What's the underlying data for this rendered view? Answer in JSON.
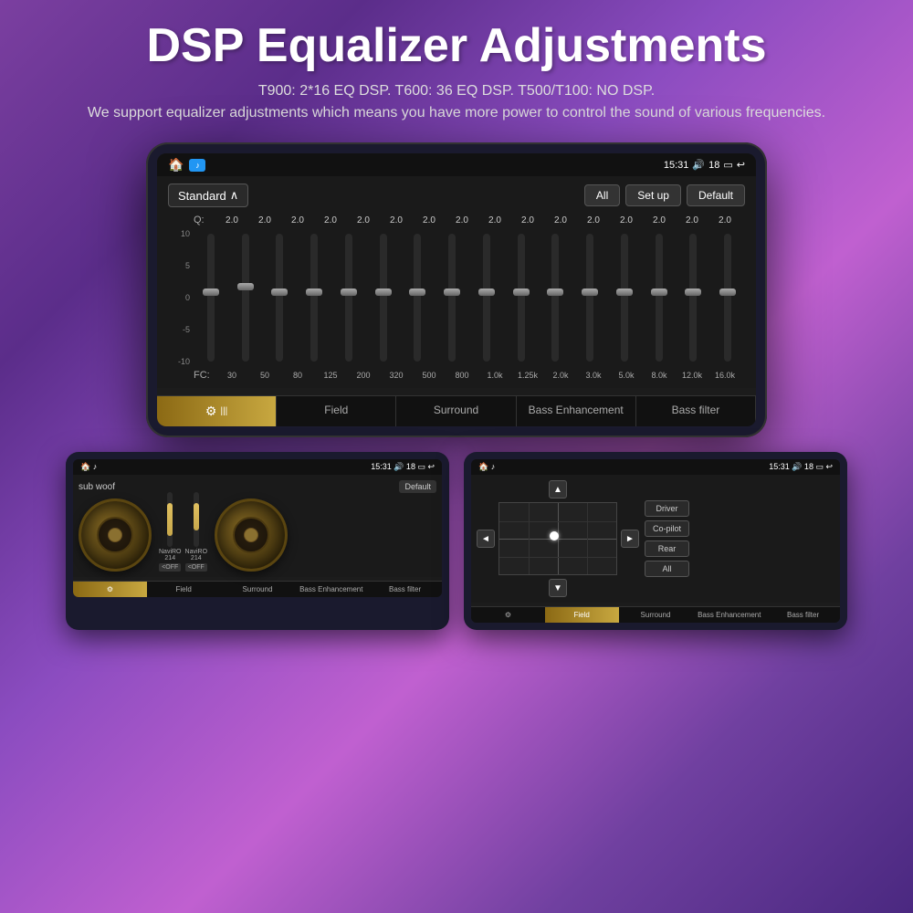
{
  "page": {
    "background": "purple gradient",
    "title": "DSP Equalizer Adjustments",
    "subtitle1": "T900: 2*16 EQ DSP.   T600: 36 EQ DSP.   T500/T100: NO DSP.",
    "subtitle2": "We support equalizer adjustments which means you have more power to control the sound of various frequencies."
  },
  "main_device": {
    "status_bar": {
      "time": "15:31",
      "volume_icon": "🔊",
      "volume_level": "18",
      "battery_icon": "🔋",
      "back_icon": "↩"
    },
    "eq_panel": {
      "preset": "Standard",
      "buttons": [
        "All",
        "Set up",
        "Default"
      ],
      "q_label": "Q:",
      "q_values": [
        "2.0",
        "2.0",
        "2.0",
        "2.0",
        "2.0",
        "2.0",
        "2.0",
        "2.0",
        "2.0",
        "2.0",
        "2.0",
        "2.0",
        "2.0",
        "2.0",
        "2.0",
        "2.0"
      ],
      "y_axis": [
        "10",
        "5",
        "0",
        "-5",
        "-10"
      ],
      "fc_label": "FC:",
      "fc_values": [
        "30",
        "50",
        "80",
        "125",
        "200",
        "320",
        "500",
        "800",
        "1.0k",
        "1.25k",
        "2.0k",
        "3.0k",
        "5.0k",
        "8.0k",
        "12.0k",
        "16.0k"
      ],
      "slider_positions": [
        0.5,
        0.5,
        0.5,
        0.5,
        0.5,
        0.5,
        0.5,
        0.5,
        0.5,
        0.5,
        0.5,
        0.5,
        0.5,
        0.5,
        0.5,
        0.5
      ]
    },
    "tabs": [
      {
        "label": "⚙",
        "sublabel": "",
        "active": true
      },
      {
        "label": "Field",
        "active": false
      },
      {
        "label": "Surround",
        "active": false
      },
      {
        "label": "Bass Enhancement",
        "active": false
      },
      {
        "label": "Bass filter",
        "active": false
      }
    ]
  },
  "bottom_left_device": {
    "status_bar": {
      "time": "15:31",
      "volume": "18"
    },
    "top_label": "sub woof",
    "default_btn": "Default",
    "slider_labels": [
      "NaviRO\n214",
      "NaviRO\n214"
    ],
    "off_labels": [
      "<OFF",
      "<OFF"
    ],
    "tabs": [
      "⚙",
      "Field",
      "Surround",
      "Bass Enhancement",
      "Bass filter"
    ]
  },
  "bottom_right_device": {
    "status_bar": {
      "time": "15:31",
      "volume": "18"
    },
    "active_tab": "Field",
    "position_buttons": [
      "Driver",
      "Co-pilot",
      "Rear",
      "All"
    ],
    "tabs": [
      "⚙",
      "Field",
      "Surround",
      "Bass Enhancement",
      "Bass filter"
    ]
  }
}
